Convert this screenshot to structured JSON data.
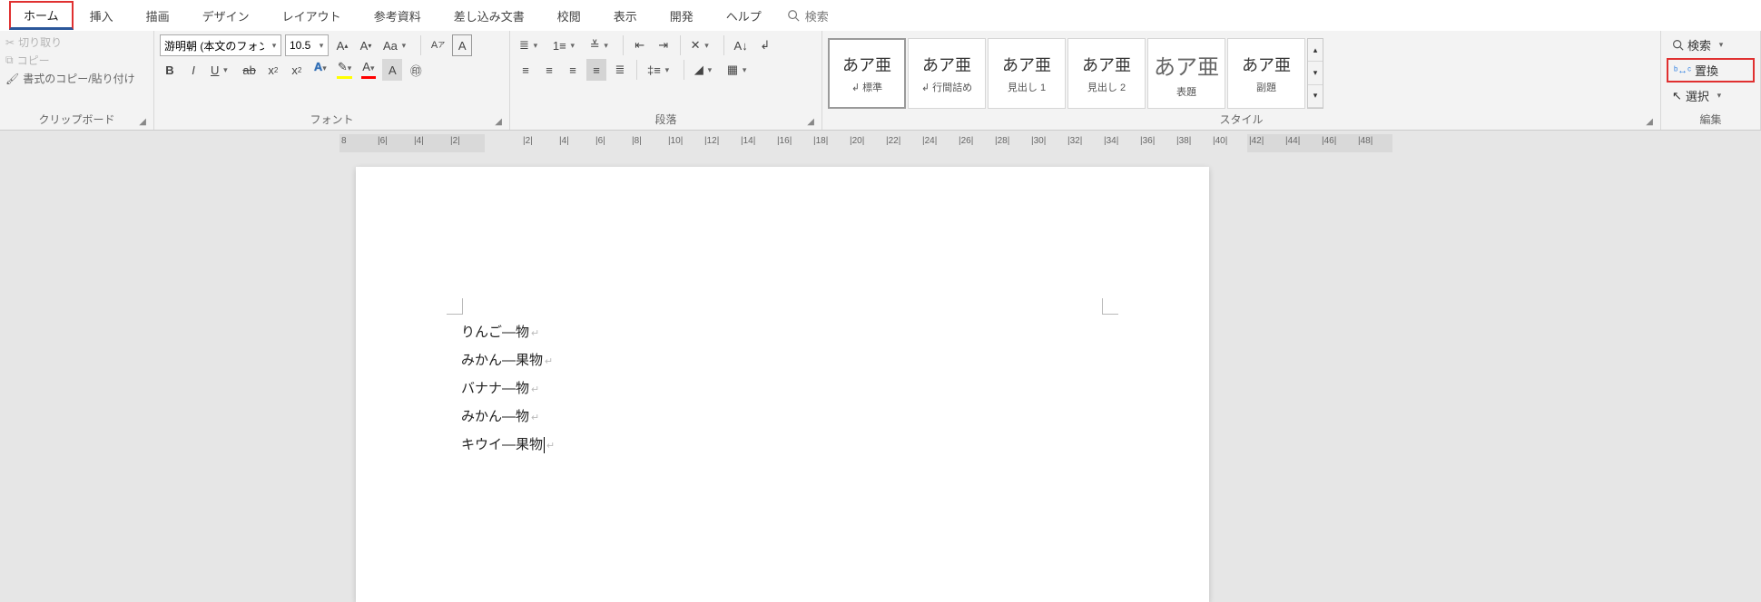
{
  "tabs": {
    "items": [
      "ホーム",
      "挿入",
      "描画",
      "デザイン",
      "レイアウト",
      "参考資料",
      "差し込み文書",
      "校閲",
      "表示",
      "開発",
      "ヘルプ"
    ],
    "active": "ホーム",
    "search_placeholder": "検索"
  },
  "clipboard": {
    "cut": "切り取り",
    "copy": "コピー",
    "format_painter": "書式のコピー/貼り付け",
    "group_label": "クリップボード"
  },
  "font": {
    "name": "游明朝 (本文のフォン",
    "size": "10.5",
    "group_label": "フォント"
  },
  "paragraph": {
    "group_label": "段落"
  },
  "styles": {
    "group_label": "スタイル",
    "items": [
      {
        "sample": "あア亜",
        "name": "↲ 標準",
        "selected": true
      },
      {
        "sample": "あア亜",
        "name": "↲ 行間詰め"
      },
      {
        "sample": "あア亜",
        "name": "見出し 1"
      },
      {
        "sample": "あア亜",
        "name": "見出し 2"
      },
      {
        "sample": "あア亜",
        "name": "表題",
        "big": true
      },
      {
        "sample": "あア亜",
        "name": "副題"
      }
    ]
  },
  "editing": {
    "find": "検索",
    "replace": "置換",
    "select": "選択",
    "group_label": "編集"
  },
  "ruler": {
    "ticks": [
      "8",
      "|6|",
      "|4|",
      "|2|",
      "",
      "|2|",
      "|4|",
      "|6|",
      "|8|",
      "|10|",
      "|12|",
      "|14|",
      "|16|",
      "|18|",
      "|20|",
      "|22|",
      "|24|",
      "|26|",
      "|28|",
      "|30|",
      "|32|",
      "|34|",
      "|36|",
      "|38|",
      "|40|",
      "|42|",
      "|44|",
      "|46|",
      "|48|"
    ]
  },
  "document": {
    "lines": [
      "りんご―物",
      "みかん―果物",
      "バナナ―物",
      "みかん―物",
      "キウイ―果物"
    ]
  }
}
